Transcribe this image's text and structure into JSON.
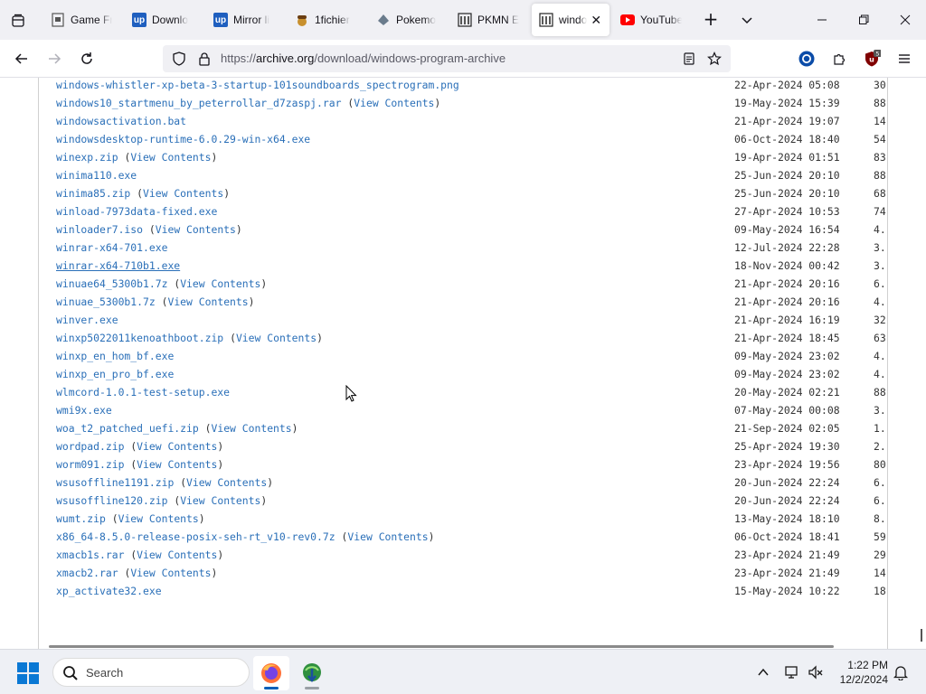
{
  "browser": {
    "tabs": [
      {
        "title": "Game Fr",
        "favicon": "page-icon",
        "active": false
      },
      {
        "title": "Downlo",
        "favicon": "up-icon",
        "active": false
      },
      {
        "title": "Mirror li",
        "favicon": "up-icon",
        "active": false
      },
      {
        "title": "1fichier",
        "favicon": "acorn-icon",
        "active": false
      },
      {
        "title": "Pokemo",
        "favicon": "pokemon-icon",
        "active": false
      },
      {
        "title": "PKMN E",
        "favicon": "archive-icon",
        "active": false
      },
      {
        "title": "windo",
        "favicon": "archive-icon",
        "active": true
      },
      {
        "title": "YouTube",
        "favicon": "youtube-icon",
        "active": false
      }
    ],
    "url": {
      "prefix": "https://",
      "host": "archive.org",
      "path": "/download/windows-program-archive"
    },
    "extension_badge": "5"
  },
  "files": [
    {
      "name": "windows-whistler-xp-beta-3-startup-101soundboards_spectrogram.png",
      "view_contents": false,
      "date": "22-Apr-2024 05:08",
      "size": "30"
    },
    {
      "name": "windows10_startmenu_by_peterrollar_d7zaspj.rar",
      "view_contents": true,
      "date": "19-May-2024 15:39",
      "size": "88"
    },
    {
      "name": "windowsactivation.bat",
      "view_contents": false,
      "date": "21-Apr-2024 19:07",
      "size": "14"
    },
    {
      "name": "windowsdesktop-runtime-6.0.29-win-x64.exe",
      "view_contents": false,
      "date": "06-Oct-2024 18:40",
      "size": "54"
    },
    {
      "name": "winexp.zip",
      "view_contents": true,
      "date": "19-Apr-2024 01:51",
      "size": "83"
    },
    {
      "name": "winima110.exe",
      "view_contents": false,
      "date": "25-Jun-2024 20:10",
      "size": "88"
    },
    {
      "name": "winima85.zip",
      "view_contents": true,
      "date": "25-Jun-2024 20:10",
      "size": "68"
    },
    {
      "name": "winload-7973data-fixed.exe",
      "view_contents": false,
      "date": "27-Apr-2024 10:53",
      "size": "74"
    },
    {
      "name": "winloader7.iso",
      "view_contents": true,
      "date": "09-May-2024 16:54",
      "size": "4."
    },
    {
      "name": "winrar-x64-701.exe",
      "view_contents": false,
      "date": "12-Jul-2024 22:28",
      "size": "3."
    },
    {
      "name": "winrar-x64-710b1.exe",
      "view_contents": false,
      "date": "18-Nov-2024 00:42",
      "size": "3.",
      "hover": true
    },
    {
      "name": "winuae64_5300b1.7z",
      "view_contents": true,
      "date": "21-Apr-2024 20:16",
      "size": "6."
    },
    {
      "name": "winuae_5300b1.7z",
      "view_contents": true,
      "date": "21-Apr-2024 20:16",
      "size": "4."
    },
    {
      "name": "winver.exe",
      "view_contents": false,
      "date": "21-Apr-2024 16:19",
      "size": "32"
    },
    {
      "name": "winxp5022011kenoathboot.zip",
      "view_contents": true,
      "date": "21-Apr-2024 18:45",
      "size": "63"
    },
    {
      "name": "winxp_en_hom_bf.exe",
      "view_contents": false,
      "date": "09-May-2024 23:02",
      "size": "4."
    },
    {
      "name": "winxp_en_pro_bf.exe",
      "view_contents": false,
      "date": "09-May-2024 23:02",
      "size": "4."
    },
    {
      "name": "wlmcord-1.0.1-test-setup.exe",
      "view_contents": false,
      "date": "20-May-2024 02:21",
      "size": "88"
    },
    {
      "name": "wmi9x.exe",
      "view_contents": false,
      "date": "07-May-2024 00:08",
      "size": "3."
    },
    {
      "name": "woa_t2_patched_uefi.zip",
      "view_contents": true,
      "date": "21-Sep-2024 02:05",
      "size": "1."
    },
    {
      "name": "wordpad.zip",
      "view_contents": true,
      "date": "25-Apr-2024 19:30",
      "size": "2."
    },
    {
      "name": "worm091.zip",
      "view_contents": true,
      "date": "23-Apr-2024 19:56",
      "size": "80"
    },
    {
      "name": "wsusoffline1191.zip",
      "view_contents": true,
      "date": "20-Jun-2024 22:24",
      "size": "6."
    },
    {
      "name": "wsusoffline120.zip",
      "view_contents": true,
      "date": "20-Jun-2024 22:24",
      "size": "6."
    },
    {
      "name": "wumt.zip",
      "view_contents": true,
      "date": "13-May-2024 18:10",
      "size": "8."
    },
    {
      "name": "x86_64-8.5.0-release-posix-seh-rt_v10-rev0.7z",
      "view_contents": true,
      "date": "06-Oct-2024 18:41",
      "size": "59"
    },
    {
      "name": "xmacb1s.rar",
      "view_contents": true,
      "date": "23-Apr-2024 21:49",
      "size": "29"
    },
    {
      "name": "xmacb2.rar",
      "view_contents": true,
      "date": "23-Apr-2024 21:49",
      "size": "14"
    },
    {
      "name": "xp_activate32.exe",
      "view_contents": false,
      "date": "15-May-2024 10:22",
      "size": "18"
    }
  ],
  "labels": {
    "view_contents": "View Contents"
  },
  "taskbar": {
    "search_label": "Search",
    "time": "1:22 PM",
    "date": "12/2/2024"
  },
  "colors": {
    "link": "#2a6fb8",
    "accent": "#005fb8"
  }
}
